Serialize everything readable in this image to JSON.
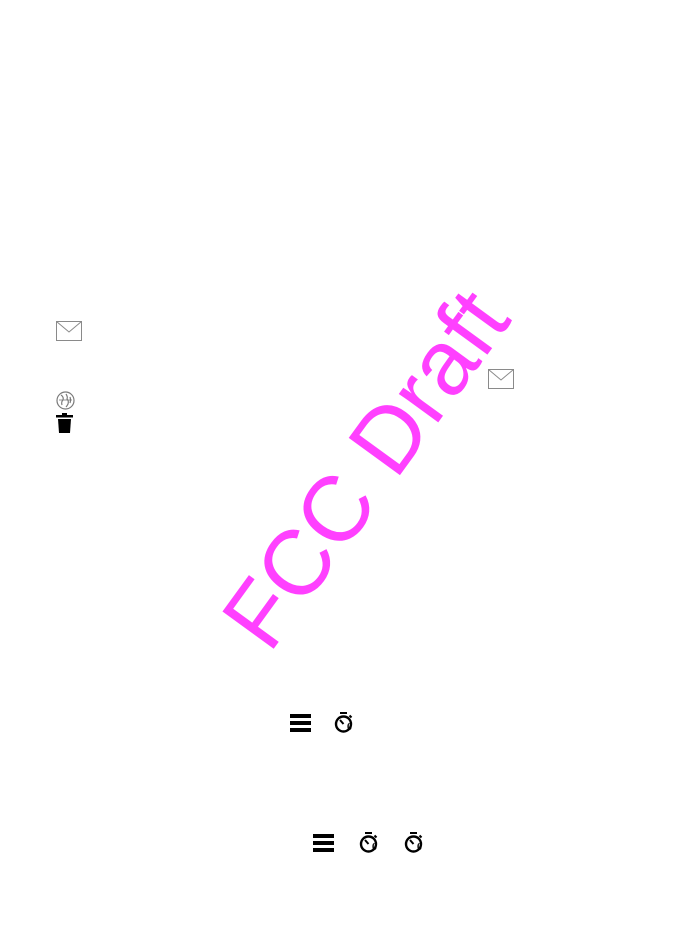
{
  "watermark": {
    "text": "FCC Draft",
    "color": "#ff40ff"
  },
  "icons": [
    {
      "name": "envelope-icon"
    },
    {
      "name": "globe-icon"
    },
    {
      "name": "trash-icon"
    },
    {
      "name": "envelope-icon"
    },
    {
      "name": "menu-icon"
    },
    {
      "name": "timer-icon",
      "label": "0"
    },
    {
      "name": "menu-icon"
    },
    {
      "name": "timer-icon",
      "label": "0"
    },
    {
      "name": "timer-icon",
      "label": "0"
    }
  ],
  "colors": {
    "icon_gray": "#8a8a8a",
    "icon_black": "#000000"
  }
}
